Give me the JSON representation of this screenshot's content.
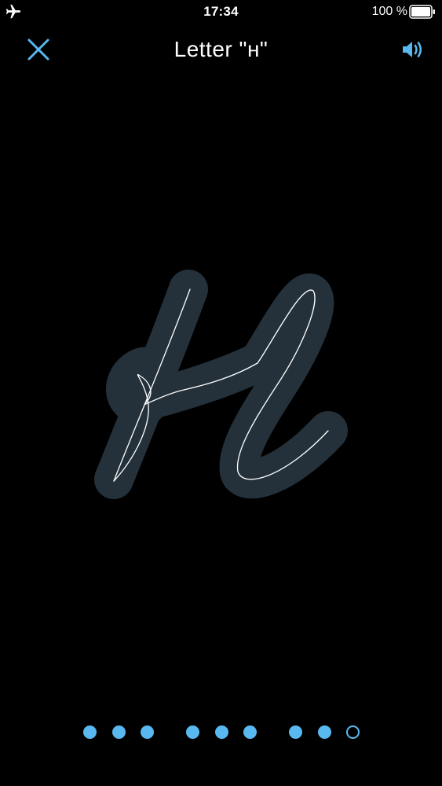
{
  "status_bar": {
    "time": "17:34",
    "battery_percent": "100 %",
    "airplane_icon": "airplane-icon",
    "battery_icon": "battery-icon"
  },
  "nav": {
    "title": "Letter \"н\"",
    "close_icon": "close-icon",
    "sound_icon": "speaker-icon"
  },
  "letter": {
    "character": "н",
    "stroke_color": "#24313a",
    "guide_color": "#ffffff"
  },
  "pagination": {
    "total": 9,
    "current_index": 8,
    "groups": [
      [
        0,
        1,
        2
      ],
      [
        3,
        4,
        5
      ],
      [
        6,
        7,
        8
      ]
    ]
  },
  "colors": {
    "accent": "#5ab8f0",
    "background": "#000000"
  }
}
